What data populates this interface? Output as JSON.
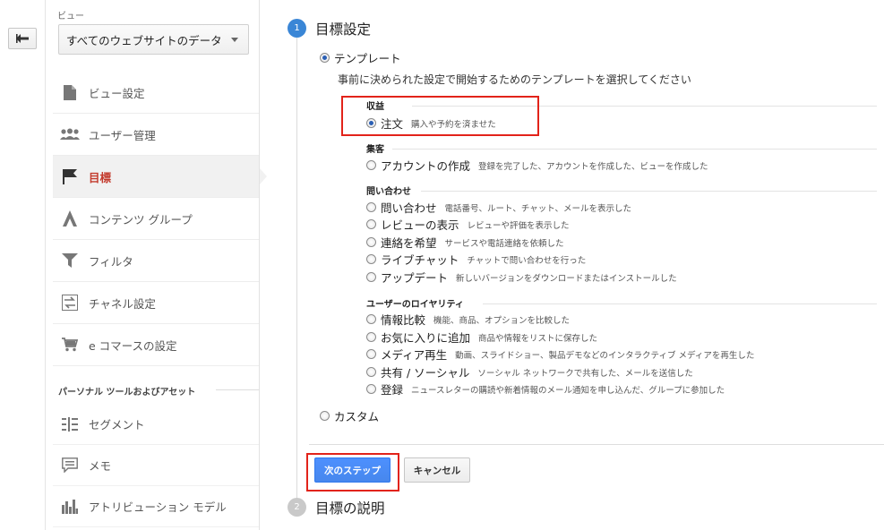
{
  "sidebar": {
    "view_label": "ビュー",
    "view_select": "すべてのウェブサイトのデータ",
    "items": [
      {
        "label": "ビュー設定",
        "icon": "document-icon"
      },
      {
        "label": "ユーザー管理",
        "icon": "users-icon"
      },
      {
        "label": "目標",
        "icon": "flag-icon",
        "active": true
      },
      {
        "label": "コンテンツ グループ",
        "icon": "content-group-icon"
      },
      {
        "label": "フィルタ",
        "icon": "filter-icon"
      },
      {
        "label": "チャネル設定",
        "icon": "channel-icon"
      },
      {
        "label": "e コマースの設定",
        "icon": "cart-icon"
      }
    ],
    "personal_title": "パーソナル ツールおよびアセット",
    "personal_items": [
      {
        "label": "セグメント",
        "icon": "segment-icon"
      },
      {
        "label": "メモ",
        "icon": "memo-icon"
      },
      {
        "label": "アトリビューション モデル",
        "icon": "bar-chart-icon"
      }
    ]
  },
  "steps": {
    "step1_number": "1",
    "step1_title": "目標設定",
    "step2_number": "2",
    "step2_title": "目標の説明"
  },
  "template": {
    "label": "テンプレート",
    "instruction": "事前に決められた設定で開始するためのテンプレートを選択してください",
    "categories": [
      {
        "title": "収益",
        "options": [
          {
            "label": "注文",
            "desc": "購入や予約を済ませた",
            "checked": true
          }
        ]
      },
      {
        "title": "集客",
        "options": [
          {
            "label": "アカウントの作成",
            "desc": "登録を完了した、アカウントを作成した、ビューを作成した"
          }
        ]
      },
      {
        "title": "問い合わせ",
        "options": [
          {
            "label": "問い合わせ",
            "desc": "電話番号、ルート、チャット、メールを表示した"
          },
          {
            "label": "レビューの表示",
            "desc": "レビューや評価を表示した"
          },
          {
            "label": "連絡を希望",
            "desc": "サービスや電話連絡を依頼した"
          },
          {
            "label": "ライブチャット",
            "desc": "チャットで問い合わせを行った"
          },
          {
            "label": "アップデート",
            "desc": "新しいバージョンをダウンロードまたはインストールした"
          }
        ]
      },
      {
        "title": "ユーザーのロイヤリティ",
        "options": [
          {
            "label": "情報比較",
            "desc": "機能、商品、オプションを比較した"
          },
          {
            "label": "お気に入りに追加",
            "desc": "商品や情報をリストに保存した"
          },
          {
            "label": "メディア再生",
            "desc": "動画、スライドショー、製品デモなどのインタラクティブ メディアを再生した"
          },
          {
            "label": "共有 / ソーシャル",
            "desc": "ソーシャル ネットワークで共有した、メールを送信した"
          },
          {
            "label": "登録",
            "desc": "ニュースレターの購読や新着情報のメール通知を申し込んだ、グループに参加した"
          }
        ]
      }
    ]
  },
  "custom_label": "カスタム",
  "buttons": {
    "next": "次のステップ",
    "cancel": "キャンセル"
  },
  "colors": {
    "accent_blue": "#4d90fe",
    "active_red": "#c33a2c",
    "highlight_red": "#e2231a"
  }
}
